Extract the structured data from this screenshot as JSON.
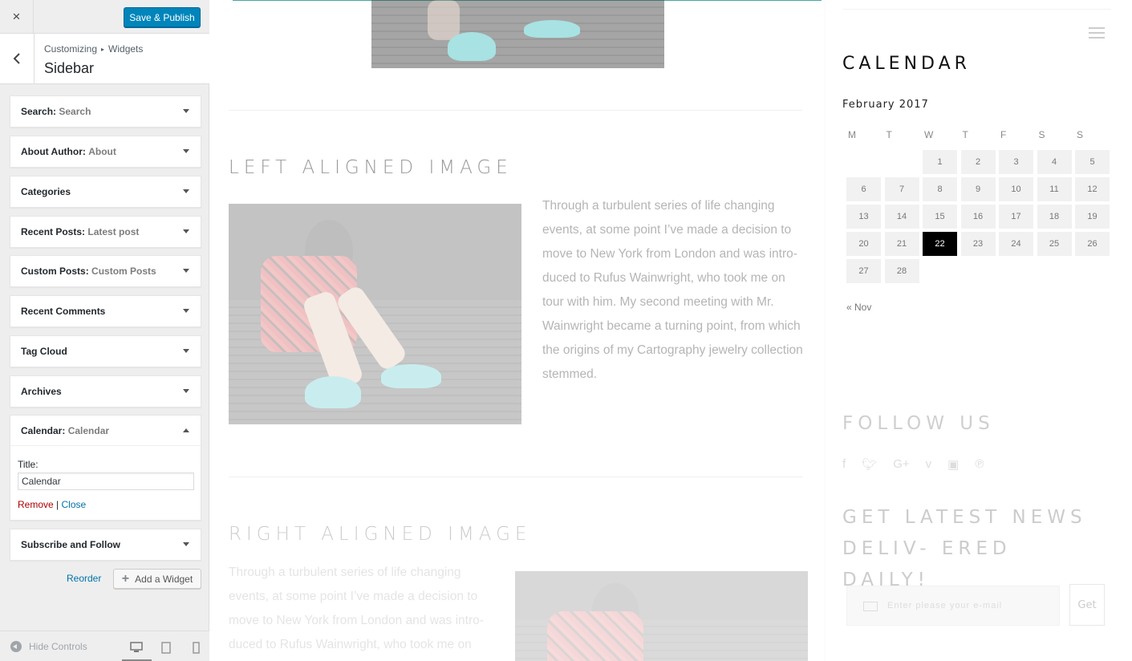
{
  "customizer": {
    "close_label": "×",
    "save_publish": "Save & Publish",
    "breadcrumb": {
      "root": "Customizing",
      "separator": "▸",
      "current": "Widgets"
    },
    "section_title": "Sidebar",
    "widgets": [
      {
        "name": "Search",
        "title": "Search"
      },
      {
        "name": "About Author",
        "title": "About"
      },
      {
        "name": "Categories",
        "title": ""
      },
      {
        "name": "Recent Posts",
        "title": "Latest post"
      },
      {
        "name": "Custom Posts",
        "title": "Custom Posts"
      },
      {
        "name": "Recent Comments",
        "title": ""
      },
      {
        "name": "Tag Cloud",
        "title": ""
      },
      {
        "name": "Archives",
        "title": ""
      },
      {
        "name": "Calendar",
        "title": "Calendar"
      },
      {
        "name": "Subscribe and Follow",
        "title": ""
      }
    ],
    "calendar_form": {
      "title_label": "Title:",
      "title_value": "Calendar",
      "remove": "Remove",
      "separator": "|",
      "close": "Close"
    },
    "reorder": "Reorder",
    "add_widget": "Add a Widget",
    "hide_controls": "Hide Controls",
    "colors": {
      "primary": "#0085ba",
      "link": "#0073aa",
      "remove": "#aa0000"
    }
  },
  "preview": {
    "posts": [
      {
        "title": "LEFT ALIGNED IMAGE",
        "text": "Through a turbulent series of life changing events, at some point I’ve made a decision to move to New York from London and was intro- duced to Rufus Wainwright, who took me on tour with him. My second meeting with Mr. Wainwright became a turning point, from which the origins of my Cartography jewelry collection stemmed."
      },
      {
        "title": "RIGHT ALIGNED IMAGE",
        "text": "Through a turbulent series of life changing events, at some point I’ve made a decision to move to New York from London and was intro- duced to Rufus Wainwright, who took me on"
      }
    ],
    "calendar": {
      "heading": "CALENDAR",
      "caption": "February 2017",
      "weekdays": [
        "M",
        "T",
        "W",
        "T",
        "F",
        "S",
        "S"
      ],
      "today": 22,
      "prev_link": "« Nov"
    },
    "follow": {
      "heading": "FOLLOW US",
      "icons": [
        "facebook-icon",
        "twitter-icon",
        "google-plus-icon",
        "vimeo-icon",
        "youtube-icon",
        "pinterest-icon"
      ]
    },
    "newsletter": {
      "heading": "GET LATEST NEWS DELIV- ERED DAILY!",
      "placeholder": "Enter please your e-mail",
      "button": "Get"
    }
  }
}
